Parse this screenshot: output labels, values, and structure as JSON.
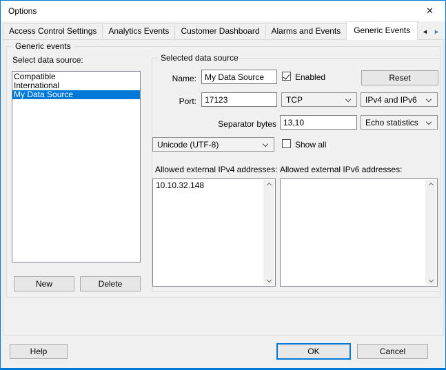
{
  "titlebar": {
    "title": "Options",
    "close_glyph": "✕"
  },
  "tabs": {
    "items": [
      {
        "label": "Access Control Settings"
      },
      {
        "label": "Analytics Events"
      },
      {
        "label": "Customer Dashboard"
      },
      {
        "label": "Alarms and Events"
      },
      {
        "label": "Generic Events"
      }
    ],
    "active_label": "Generic Events",
    "scroll_left_glyph": "◄",
    "scroll_right_glyph": "►"
  },
  "generic_events": {
    "group_label": "Generic events",
    "select_label": "Select data source:",
    "list": {
      "items": [
        "Compatible",
        "International",
        "My Data Source"
      ],
      "selected": "My Data Source"
    },
    "new_button": "New",
    "delete_button": "Delete"
  },
  "selected_data_source": {
    "group_label": "Selected data source",
    "name_label": "Name:",
    "name_value": "My Data Source",
    "enabled_label": "Enabled",
    "enabled_checked": true,
    "reset_button": "Reset",
    "port_label": "Port:",
    "port_value": "17123",
    "protocol_value": "TCP",
    "ip_version_value": "IPv4 and IPv6",
    "separator_label": "Separator bytes",
    "separator_value": "13,10",
    "echo_value": "Echo statistics",
    "encoding_value": "Unicode (UTF-8)",
    "show_all_label": "Show all",
    "show_all_checked": false,
    "ipv4_label": "Allowed external IPv4 addresses:",
    "ipv6_label": "Allowed external IPv6 addresses:",
    "ipv4_value": "10.10.32.148",
    "ipv6_value": ""
  },
  "footer": {
    "help_button": "Help",
    "ok_button": "OK",
    "cancel_button": "Cancel"
  },
  "colors": {
    "accent": "#0078d7",
    "selection_bg": "#0078d7",
    "dialog_bg": "#f0f0f0",
    "titlebar_bg": "#ffffff"
  }
}
